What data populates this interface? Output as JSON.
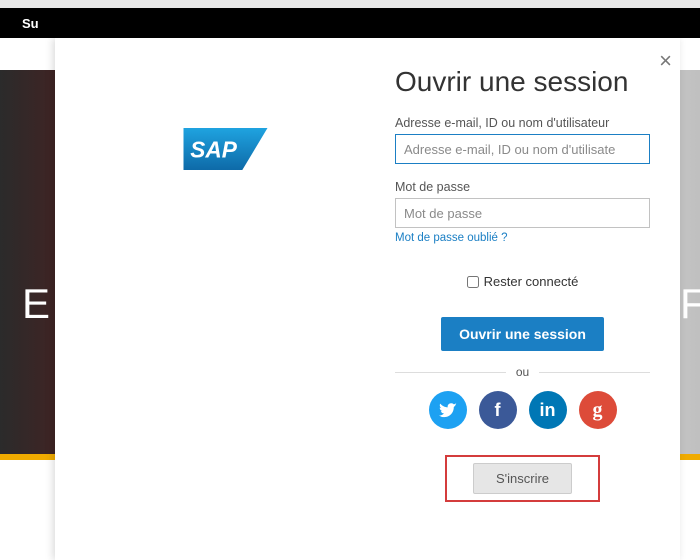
{
  "topbar": {
    "label": "Su"
  },
  "background": {
    "left_text": "E",
    "right_text": "F"
  },
  "modal": {
    "title": "Ouvrir une session",
    "email": {
      "label": "Adresse e-mail, ID ou nom d'utilisateur",
      "placeholder": "Adresse e-mail, ID ou nom d'utilisate"
    },
    "password": {
      "label": "Mot de passe",
      "placeholder": "Mot de passe"
    },
    "forgot": "Mot de passe oublié ?",
    "remember": "Rester connecté",
    "login_button": "Ouvrir une session",
    "divider": "ou",
    "signup_button": "S'inscrire",
    "close": "×",
    "social": {
      "twitter": "twitter-icon",
      "facebook": "facebook-icon",
      "linkedin": "linkedin-icon",
      "google": "google-icon"
    }
  }
}
